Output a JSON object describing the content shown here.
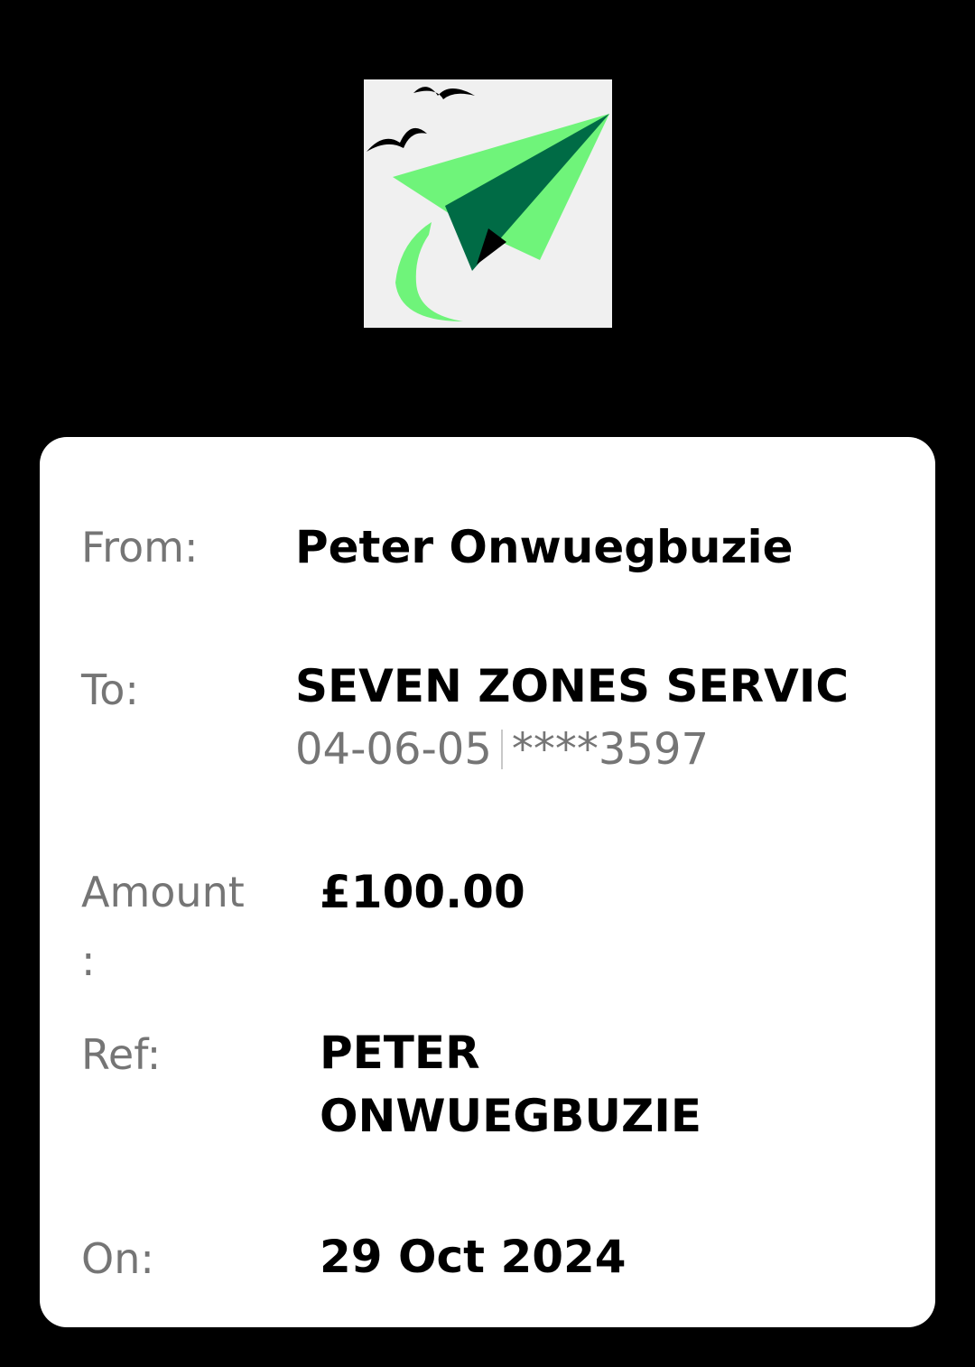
{
  "colors": {
    "background": "#000000",
    "card": "#ffffff",
    "label": "#757575",
    "value": "#000000",
    "logo_bg": "#f0f0f0",
    "logo_light_green": "#6ff47a",
    "logo_dark_green": "#006b45"
  },
  "logo": {
    "icon": "paper-plane-with-birds-logo"
  },
  "transfer": {
    "from_label": "From:",
    "from_value": "Peter Onwuegbuzie",
    "to_label": "To:",
    "to_value": "SEVEN ZONES SERVIC",
    "sort_code": "04-06-05",
    "account_masked": "****3597",
    "amount_label": "Amount :",
    "amount_value": "£100.00",
    "ref_label": "Ref:",
    "ref_line1": "PETER",
    "ref_line2": "ONWUEGBUZIE",
    "on_label": "On:",
    "on_value": "29 Oct 2024"
  }
}
